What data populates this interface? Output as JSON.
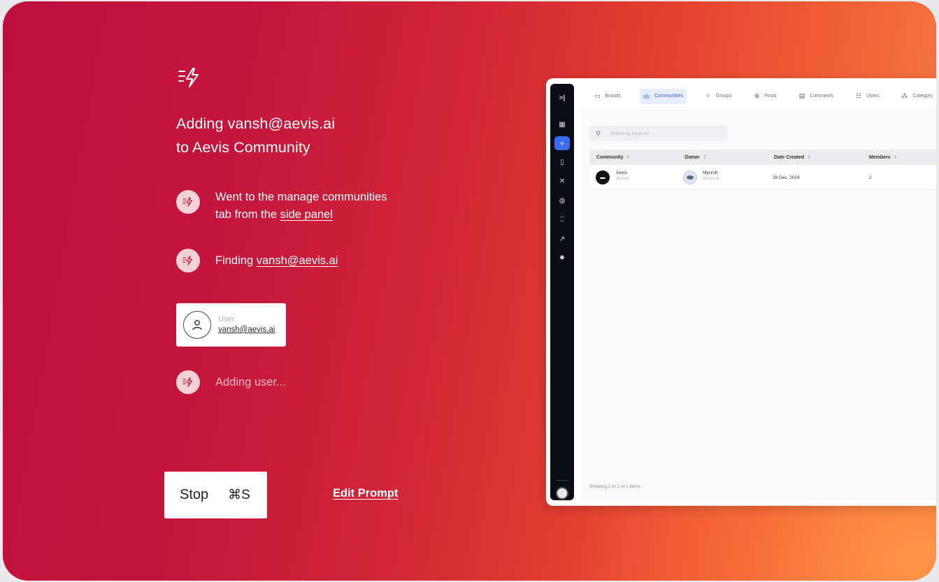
{
  "agent": {
    "title_line1": "Adding vansh@aevis.ai",
    "title_line2": "to Aevis Community",
    "steps": [
      {
        "text_before": "Went to the manage communities",
        "text_line2": "tab from the",
        "link": "side panel"
      },
      {
        "text_before": "Finding",
        "link": "vansh@aevis.ai"
      },
      {
        "text_before": "Adding user..."
      }
    ],
    "user_card": {
      "label": "User",
      "value": "vansh@aevis.ai"
    },
    "stop_button": {
      "label": "Stop",
      "shortcut": "⌘S"
    },
    "edit_prompt": "Edit Prompt"
  },
  "app": {
    "rail_toggle": ">|",
    "tabs": [
      {
        "label": "Brands",
        "icon": "briefcase-icon",
        "glyph": "▭"
      },
      {
        "label": "Communities",
        "icon": "people-icon",
        "glyph": "ıılı",
        "active": true
      },
      {
        "label": "Groups",
        "icon": "groups-icon",
        "glyph": "✧"
      },
      {
        "label": "Posts",
        "icon": "posts-icon",
        "glyph": "⊕"
      },
      {
        "label": "Comments",
        "icon": "comments-icon",
        "glyph": "▤"
      },
      {
        "label": "Users",
        "icon": "users-icon",
        "glyph": "☷"
      },
      {
        "label": "Category",
        "icon": "category-icon",
        "glyph": "⁂"
      }
    ],
    "search_placeholder": "Search by keyword",
    "table": {
      "headers": [
        "Community",
        "Owner",
        "Date Created",
        "Members"
      ],
      "sort_glyph": "⇕",
      "rows": [
        {
          "community": "Aevis",
          "community_handle": "@aevis",
          "owner": "Mycroft",
          "owner_handle": "@mycroft",
          "date": "28 Dec, 2024",
          "members": "2"
        }
      ]
    },
    "footer": "Showing 1 to 1 of 1 items"
  },
  "colors": {
    "gradient_start": "#bd0f3e",
    "gradient_end": "#f98246",
    "accent": "#3b6cf5"
  }
}
